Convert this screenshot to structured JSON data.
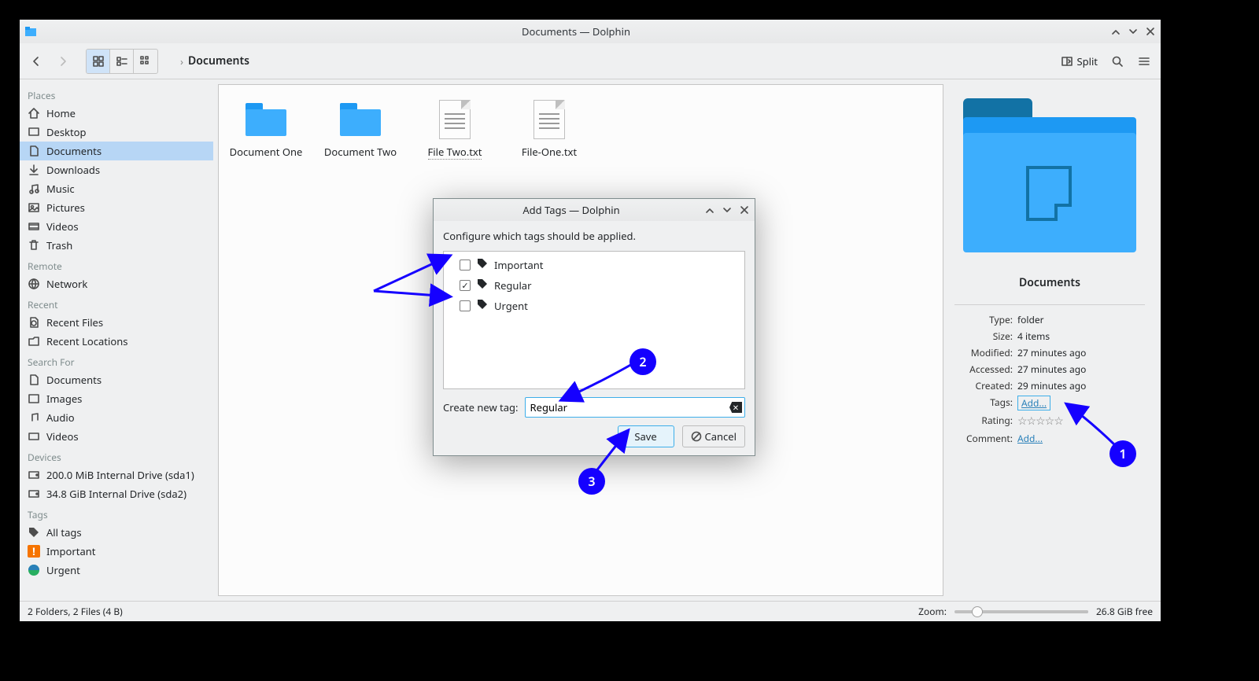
{
  "titlebar": {
    "title": "Documents — Dolphin"
  },
  "toolbar": {
    "split_label": "Split",
    "breadcrumb": {
      "current": "Documents"
    }
  },
  "sidebar": {
    "sections": {
      "places": "Places",
      "remote": "Remote",
      "recent": "Recent",
      "search": "Search For",
      "devices": "Devices",
      "tags": "Tags"
    },
    "places_items": [
      "Home",
      "Desktop",
      "Documents",
      "Downloads",
      "Music",
      "Pictures",
      "Videos",
      "Trash"
    ],
    "remote_items": [
      "Network"
    ],
    "recent_items": [
      "Recent Files",
      "Recent Locations"
    ],
    "search_items": [
      "Documents",
      "Images",
      "Audio",
      "Videos"
    ],
    "devices_items": [
      "200.0 MiB Internal Drive (sda1)",
      "34.8 GiB Internal Drive (sda2)"
    ],
    "tags_items": [
      "All tags",
      "Important",
      "Urgent"
    ]
  },
  "files": [
    {
      "name": "Document One",
      "type": "folder"
    },
    {
      "name": "Document Two",
      "type": "folder"
    },
    {
      "name": "File Two.txt",
      "type": "txt",
      "selected": true
    },
    {
      "name": "File-One.txt",
      "type": "txt"
    }
  ],
  "info": {
    "title": "Documents",
    "type_label": "Type:",
    "type_value": "folder",
    "size_label": "Size:",
    "size_value": "4 items",
    "modified_label": "Modified:",
    "modified_value": "27 minutes ago",
    "accessed_label": "Accessed:",
    "accessed_value": "27 minutes ago",
    "created_label": "Created:",
    "created_value": "29 minutes ago",
    "tags_label": "Tags:",
    "tags_value": "Add...",
    "rating_label": "Rating:",
    "comment_label": "Comment:",
    "comment_value": "Add..."
  },
  "statusbar": {
    "summary": "2 Folders, 2 Files (4 B)",
    "zoom_label": "Zoom:",
    "free_space": "26.8 GiB free"
  },
  "dialog": {
    "title": "Add Tags — Dolphin",
    "hint": "Configure which tags should be applied.",
    "tags": [
      {
        "label": "Important",
        "checked": false
      },
      {
        "label": "Regular",
        "checked": true
      },
      {
        "label": "Urgent",
        "checked": false
      }
    ],
    "create_label": "Create new tag:",
    "create_value": "Regular",
    "save_label": "Save",
    "cancel_label": "Cancel"
  },
  "annotations": {
    "b1": "1",
    "b2": "2",
    "b3": "3"
  }
}
